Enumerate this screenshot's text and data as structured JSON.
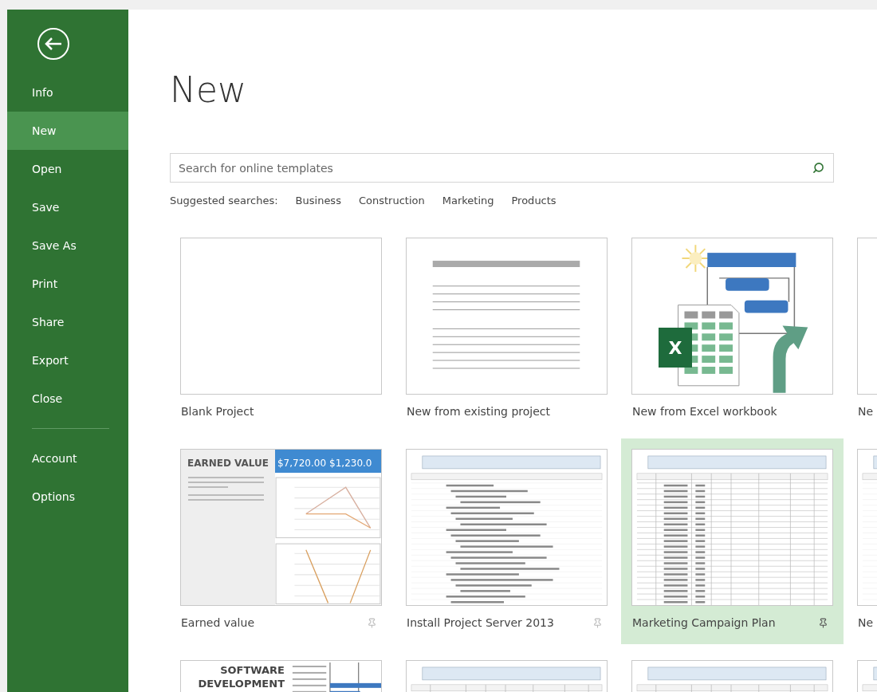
{
  "sidebar": {
    "items": [
      {
        "label": "Info",
        "selected": false
      },
      {
        "label": "New",
        "selected": true
      },
      {
        "label": "Open",
        "selected": false
      },
      {
        "label": "Save",
        "selected": false
      },
      {
        "label": "Save As",
        "selected": false
      },
      {
        "label": "Print",
        "selected": false
      },
      {
        "label": "Share",
        "selected": false
      },
      {
        "label": "Export",
        "selected": false
      },
      {
        "label": "Close",
        "selected": false
      }
    ],
    "bottom_items": [
      {
        "label": "Account",
        "selected": false
      },
      {
        "label": "Options",
        "selected": false
      }
    ]
  },
  "title": "New",
  "search": {
    "placeholder": "Search for online templates"
  },
  "suggested": {
    "label": "Suggested searches:",
    "links": [
      "Business",
      "Construction",
      "Marketing",
      "Products"
    ]
  },
  "templates": [
    [
      {
        "kind": "blank",
        "label": "Blank Project",
        "selected": false
      },
      {
        "kind": "lines",
        "label": "New from existing project",
        "selected": false
      },
      {
        "kind": "excel",
        "label": "New from Excel workbook",
        "logo": "X",
        "selected": false
      },
      {
        "kind": "blank",
        "label": "Ne",
        "selected": false
      }
    ],
    [
      {
        "kind": "earned",
        "label": "Earned value",
        "heading": "EARNED VALUE",
        "amounts": [
          "$7,720.00",
          "$1,230.0"
        ],
        "selected": false,
        "pin": true
      },
      {
        "kind": "table",
        "label": "Install Project Server 2013",
        "selected": false,
        "pin": true
      },
      {
        "kind": "gantt",
        "label": "Marketing Campaign Plan",
        "selected": true,
        "pin": true
      },
      {
        "kind": "table",
        "label": "Ne",
        "selected": false
      }
    ],
    [
      {
        "kind": "software",
        "heading": "SOFTWARE DEVELOPMENT",
        "selected": false
      },
      {
        "kind": "gantt",
        "selected": false
      },
      {
        "kind": "gantt",
        "selected": false
      },
      {
        "kind": "table",
        "selected": false
      }
    ]
  ]
}
